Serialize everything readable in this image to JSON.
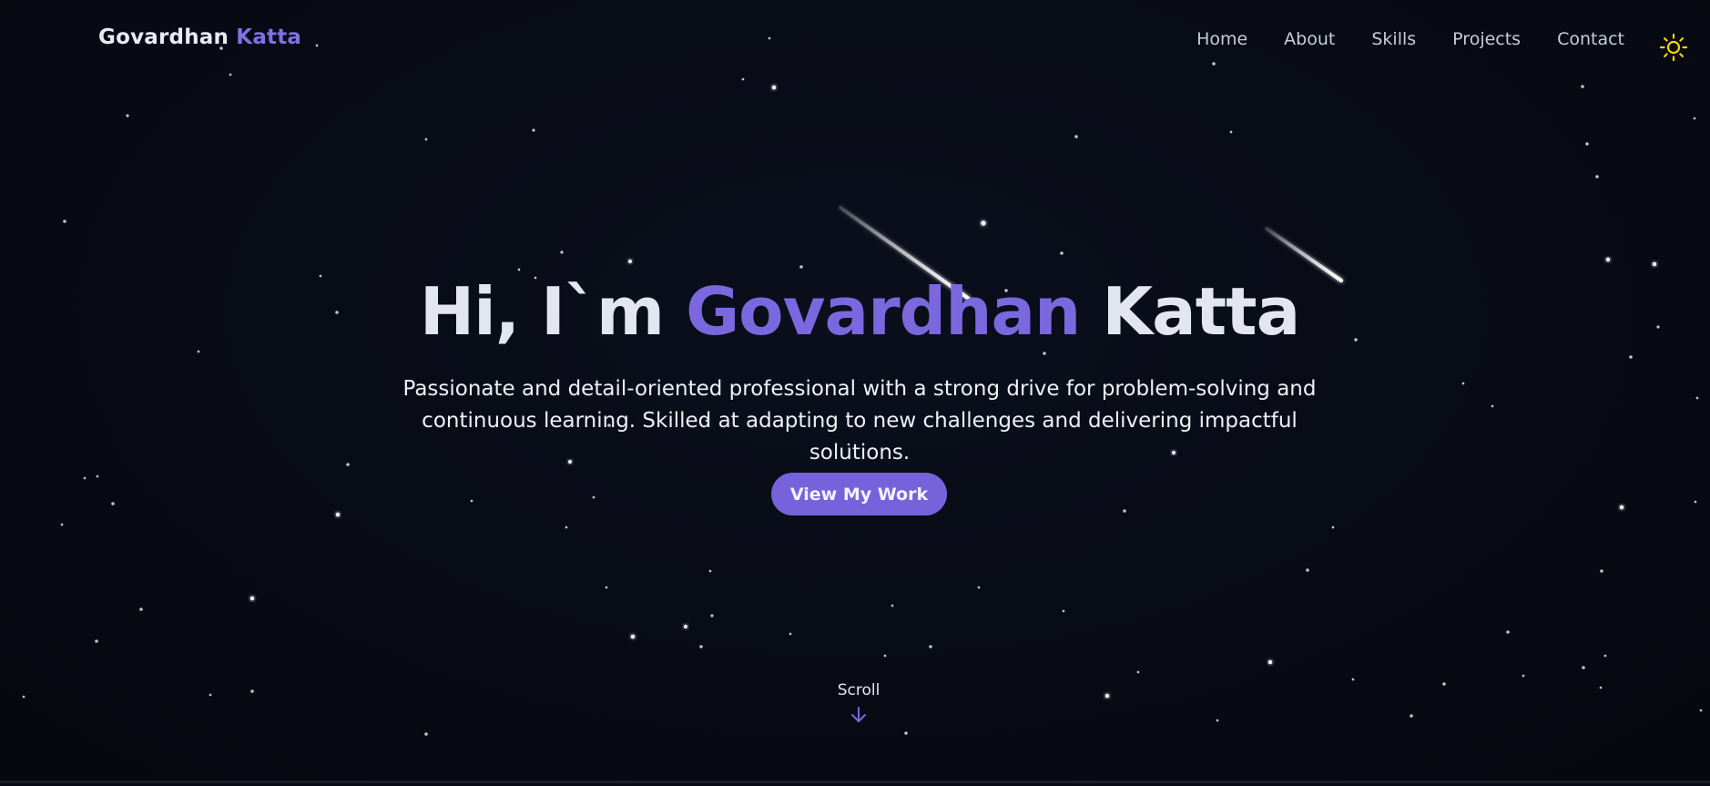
{
  "header": {
    "logo_first": "Govardhan",
    "logo_last": "Katta",
    "nav": [
      {
        "label": "Home"
      },
      {
        "label": "About"
      },
      {
        "label": "Skills"
      },
      {
        "label": "Projects"
      },
      {
        "label": "Contact"
      }
    ],
    "theme_toggle_icon": "sun-icon"
  },
  "hero": {
    "greeting": "Hi, I`m",
    "first_name": "Govardhan",
    "last_name": "Katta",
    "description": "Passionate and detail-oriented professional with a strong drive for problem-solving and continuous learning. Skilled at adapting to new challenges and delivering impactful solutions.",
    "cta_label": "View My Work",
    "scroll_label": "Scroll",
    "scroll_icon": "arrow-down-icon"
  },
  "colors": {
    "background": "#080b14",
    "accent": "#7b68de",
    "sun": "#f5d20a",
    "text": "#e3e6f0"
  }
}
